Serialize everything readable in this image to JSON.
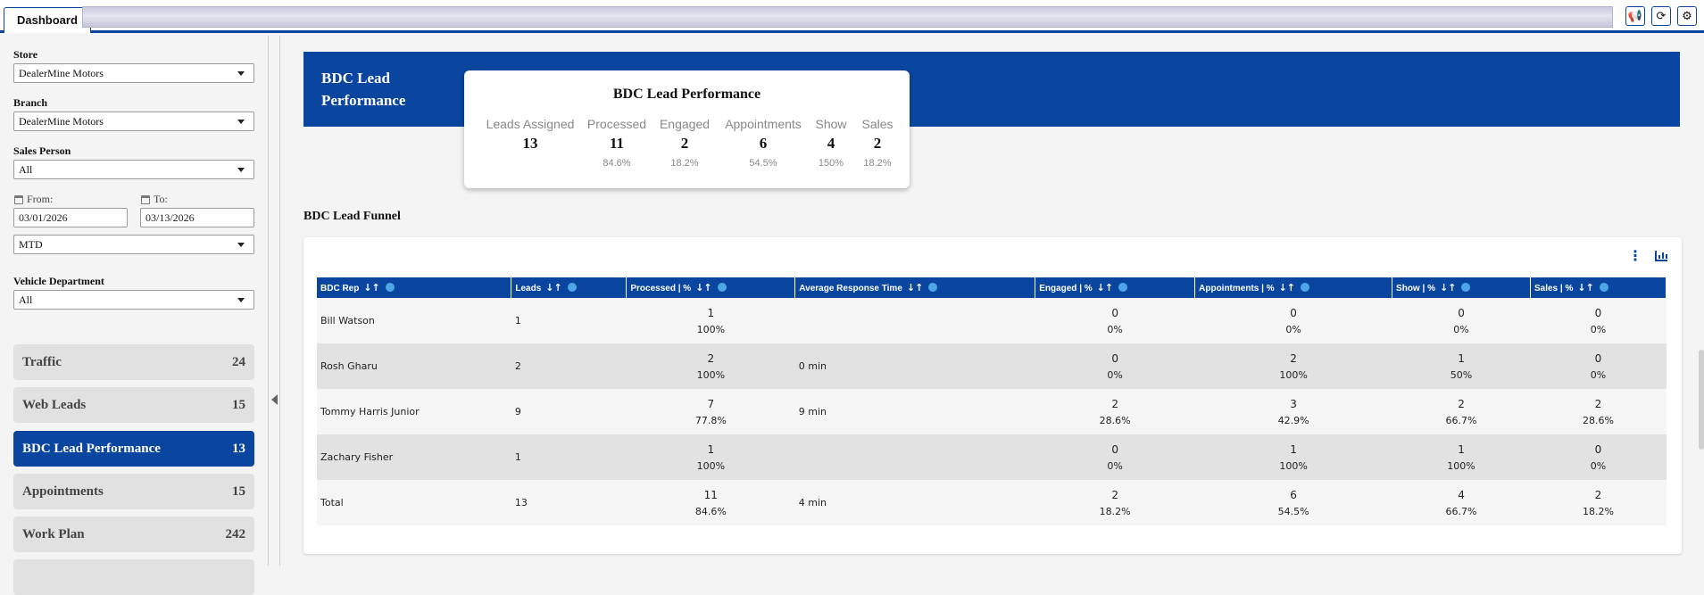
{
  "tab": {
    "label": "Dashboard"
  },
  "toolbar": {
    "icons": [
      "megaphone-icon",
      "refresh-icon",
      "gear-icon"
    ]
  },
  "sidebar": {
    "store": {
      "label": "Store",
      "value": "DealerMine Motors"
    },
    "branch": {
      "label": "Branch",
      "value": "DealerMine Motors"
    },
    "sales_person": {
      "label": "Sales Person",
      "value": "All"
    },
    "from": {
      "label": "From:",
      "value": "03/01/2026"
    },
    "to": {
      "label": "To:",
      "value": "03/13/2026"
    },
    "period": {
      "value": "MTD"
    },
    "vehicle_department": {
      "label": "Vehicle Department",
      "value": "All"
    },
    "nav": [
      {
        "label": "Traffic",
        "count": "24"
      },
      {
        "label": "Web Leads",
        "count": "15"
      },
      {
        "label": "BDC Lead Performance",
        "count": "13",
        "active": true
      },
      {
        "label": "Appointments",
        "count": "15"
      },
      {
        "label": "Work Plan",
        "count": "242"
      }
    ]
  },
  "banner": {
    "title": "BDC Lead Performance"
  },
  "performance": {
    "title": "BDC Lead Performance",
    "metrics": [
      {
        "label": "Leads Assigned",
        "value": "13",
        "pct": ""
      },
      {
        "label": "Processed",
        "value": "11",
        "pct": "84.6%"
      },
      {
        "label": "Engaged",
        "value": "2",
        "pct": "18.2%"
      },
      {
        "label": "Appointments",
        "value": "6",
        "pct": "54.5%"
      },
      {
        "label": "Show",
        "value": "4",
        "pct": "150%"
      },
      {
        "label": "Sales",
        "value": "2",
        "pct": "18.2%"
      }
    ]
  },
  "funnel": {
    "title": "BDC Lead Funnel",
    "columns": [
      "BDC Rep",
      "Leads",
      "Processed | %",
      "Average Response Time",
      "Engaged | %",
      "Appointments | %",
      "Show | %",
      "Sales | %"
    ],
    "rows": [
      {
        "rep": "Bill Watson",
        "leads": "1",
        "processed": [
          "1",
          "100%"
        ],
        "response": "",
        "engaged": [
          "0",
          "0%"
        ],
        "appointments": [
          "0",
          "0%"
        ],
        "show": [
          "0",
          "0%"
        ],
        "sales": [
          "0",
          "0%"
        ]
      },
      {
        "rep": "Rosh Gharu",
        "leads": "2",
        "processed": [
          "2",
          "100%"
        ],
        "response": "0 min",
        "engaged": [
          "0",
          "0%"
        ],
        "appointments": [
          "2",
          "100%"
        ],
        "show": [
          "1",
          "50%"
        ],
        "sales": [
          "0",
          "0%"
        ]
      },
      {
        "rep": "Tommy Harris Junior",
        "leads": "9",
        "processed": [
          "7",
          "77.8%"
        ],
        "response": "9 min",
        "engaged": [
          "2",
          "28.6%"
        ],
        "appointments": [
          "3",
          "42.9%"
        ],
        "show": [
          "2",
          "66.7%"
        ],
        "sales": [
          "2",
          "28.6%"
        ]
      },
      {
        "rep": "Zachary Fisher",
        "leads": "1",
        "processed": [
          "1",
          "100%"
        ],
        "response": "",
        "engaged": [
          "0",
          "0%"
        ],
        "appointments": [
          "1",
          "100%"
        ],
        "show": [
          "1",
          "100%"
        ],
        "sales": [
          "0",
          "0%"
        ]
      },
      {
        "rep": "Total",
        "leads": "13",
        "processed": [
          "11",
          "84.6%"
        ],
        "response": "4 min",
        "engaged": [
          "2",
          "18.2%"
        ],
        "appointments": [
          "6",
          "54.5%"
        ],
        "show": [
          "4",
          "66.7%"
        ],
        "sales": [
          "2",
          "18.2%"
        ]
      }
    ]
  }
}
